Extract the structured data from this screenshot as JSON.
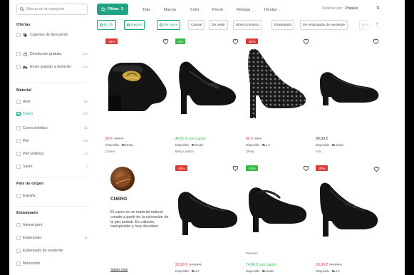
{
  "search": {
    "placeholder": "Buscar en la categoría"
  },
  "sidebar": {
    "ofertas_title": "Ofertas",
    "ofertas": [
      {
        "label": "Cupones de descuento",
        "count": ""
      },
      {
        "label": "Devolución gratuita",
        "count": "372"
      },
      {
        "label": "Envío gratuito a domicilio",
        "count": "213"
      }
    ],
    "material_title": "Material",
    "material": [
      {
        "label": "Ante",
        "count": "66",
        "checked": false
      },
      {
        "label": "Cuero",
        "count": "378",
        "checked": true
      },
      {
        "label": "Cuero sintético",
        "count": "61",
        "checked": false
      },
      {
        "label": "Piel",
        "count": "419",
        "checked": false
      },
      {
        "label": "Piel sintética",
        "count": "13",
        "checked": false
      },
      {
        "label": "Satén",
        "count": "1",
        "checked": false
      }
    ],
    "origen_title": "País de origen",
    "origen": [
      {
        "label": "España",
        "count": ""
      }
    ],
    "estampado_title": "Estampado",
    "estampado": [
      {
        "label": "Animal print",
        "count": ""
      },
      {
        "label": "Estampado",
        "count": "11"
      },
      {
        "label": "Estampado de serpiente",
        "count": ""
      },
      {
        "label": "Monocolor",
        "count": ""
      }
    ]
  },
  "topbar": {
    "filter_label": "Filtrar",
    "filter_count": "3",
    "menus": [
      "Talla",
      "Marcas",
      "Color",
      "Precio",
      "Rebajas",
      "Tiendas"
    ],
    "sort_label": "Ordenar por:",
    "sort_value": "Popular"
  },
  "chips": [
    {
      "label": "En 3h",
      "active": true
    },
    {
      "label": "Negros",
      "active": true
    },
    {
      "label": "De cuero",
      "active": true
    },
    {
      "label": "Casual",
      "active": false
    },
    {
      "label": "De vestir",
      "active": false
    },
    {
      "label": "Monocromático",
      "active": false
    },
    {
      "label": "Estampado",
      "active": false
    },
    {
      "label": "De estampado de serpiente",
      "active": false
    },
    {
      "label": "Animal",
      "active": false
    }
  ],
  "products": [
    {
      "badge": "-48%",
      "badge_color": "red",
      "price": "80 €",
      "old_price": "159 €",
      "price_color": "red",
      "availability": "Disponible",
      "shipping": "Gratis",
      "brand": "Camel"
    },
    {
      "badge": "-5%",
      "badge_color": "green",
      "price": "46,55 € con cupón",
      "old_price": "",
      "price_color": "green",
      "availability": "Disponible",
      "shipping": "Gratis",
      "brand": "Betty London"
    },
    {
      "badge": "-32%",
      "badge_color": "red",
      "price": "55 €",
      "old_price": "81 €",
      "price_color": "red",
      "availability": "Disponible",
      "shipping": "4 €",
      "brand": "Oleky"
    },
    {
      "badge": "",
      "badge_color": "",
      "price": "99,90 €",
      "old_price": "",
      "price_color": "",
      "availability": "Disponible",
      "shipping": "Gratis",
      "brand": "Ara"
    },
    {
      "badge": "-20%",
      "badge_color": "red",
      "price": "29,99 €",
      "old_price": "37,99 €",
      "price_color": "red",
      "availability": "Disponible",
      "shipping": "4 €",
      "brand": "",
      "premium": ""
    },
    {
      "badge": "-15%",
      "badge_color": "green",
      "price": "74,80 € con cupón",
      "old_price": "",
      "price_color": "green",
      "availability": "Disponible",
      "shipping": "Gratis",
      "brand": "",
      "premium": "Premium"
    },
    {
      "badge": "-30%",
      "badge_color": "red",
      "price": "29,99 €",
      "old_price": "39,99 €",
      "price_color": "red",
      "availability": "Disponible",
      "shipping": "4 €",
      "brand": ""
    }
  ],
  "info": {
    "title": "CUERO",
    "text": "El cuero es un material natural creado a partir de la coloración de la piel animal. Es caliente, transpirable y muy duradero.",
    "link": "Saber más"
  }
}
